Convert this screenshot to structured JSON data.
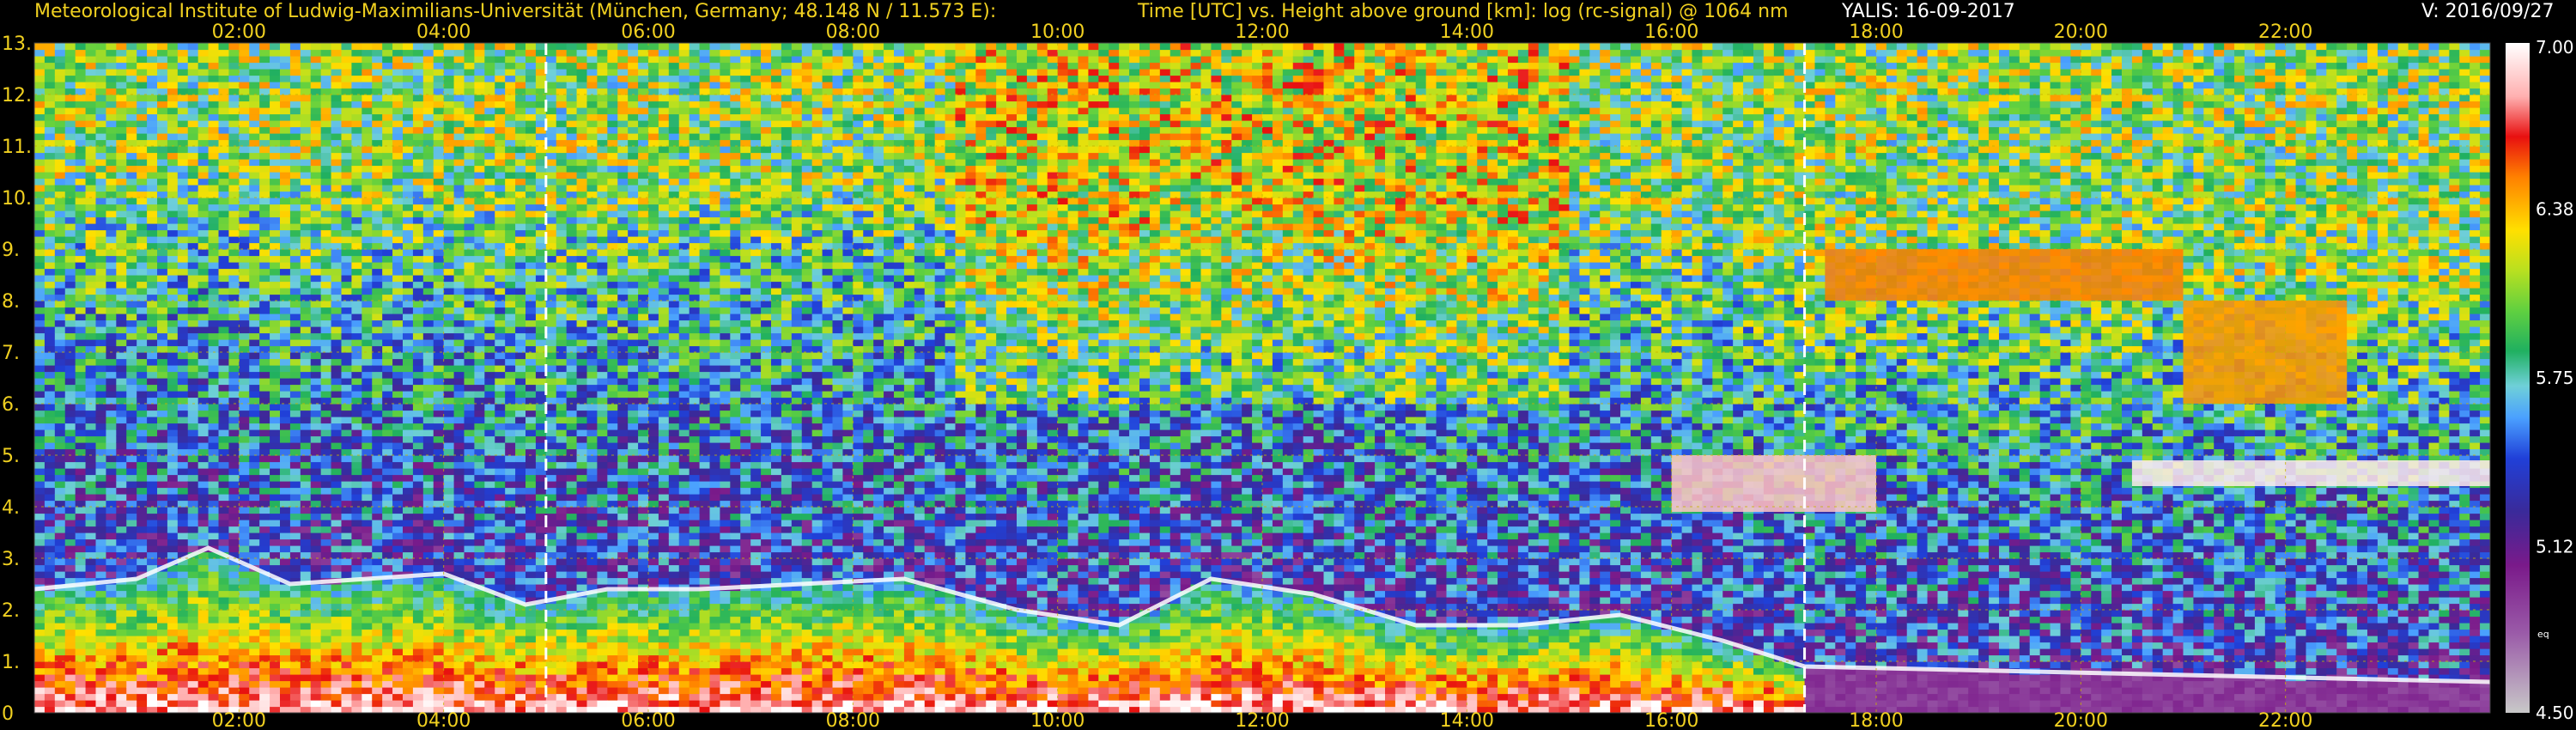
{
  "header": {
    "institute": "Meteorological Institute of Ludwig-Maximilians-Universität (München, Germany; 48.148 N / 11.573 E):",
    "description": "Time [UTC] vs. Height above ground [km]: log (rc-signal) @ 1064 nm",
    "instrument": "YALIS: 16-09-2017",
    "version": "V: 2016/09/27"
  },
  "colors": {
    "header_text": "#f0d020",
    "tick_text": "#f0d020",
    "grid": "#c8b400",
    "background": "#000000",
    "marker_line": "#ffffff",
    "colorbar_text": "#ffffff"
  },
  "chart_data": {
    "type": "heatmap",
    "x_unit": "hours UTC",
    "y_unit": "km",
    "x_range": [
      0,
      24
    ],
    "y_range": [
      0,
      13
    ],
    "x_ticks": [
      2,
      4,
      6,
      8,
      10,
      12,
      14,
      16,
      18,
      20,
      22
    ],
    "x_tick_labels": [
      "02:00",
      "04:00",
      "06:00",
      "08:00",
      "10:00",
      "12:00",
      "14:00",
      "16:00",
      "18:00",
      "20:00",
      "22:00"
    ],
    "y_ticks": [
      0,
      1,
      2,
      3,
      4,
      5,
      6,
      7,
      8,
      9,
      10,
      11,
      12,
      13
    ],
    "y_tick_labels": [
      "0",
      "1.",
      "2.",
      "3.",
      "4.",
      "5.",
      "6.",
      "7.",
      "8.",
      "9.",
      "10.",
      "11.",
      "12.",
      "13."
    ],
    "grid": true,
    "dashed_markers_x": [
      5.0,
      17.3
    ],
    "colorbar": {
      "range": [
        4.5,
        7.0
      ],
      "tick_values": [
        4.5,
        5.12,
        5.75,
        6.38,
        7.0
      ],
      "tick_labels": [
        "4.50",
        "5.12",
        "5.75",
        "6.38",
        "7.00"
      ],
      "note": "eq",
      "stops": [
        {
          "value": 4.5,
          "color": "#c8c8c8"
        },
        {
          "value": 4.8,
          "color": "#9a5aa8"
        },
        {
          "value": 5.05,
          "color": "#7a1a8a"
        },
        {
          "value": 5.25,
          "color": "#3a2a9a"
        },
        {
          "value": 5.45,
          "color": "#2040d8"
        },
        {
          "value": 5.6,
          "color": "#4aa0ff"
        },
        {
          "value": 5.72,
          "color": "#6fd0d8"
        },
        {
          "value": 5.85,
          "color": "#20b060"
        },
        {
          "value": 6.0,
          "color": "#60d040"
        },
        {
          "value": 6.15,
          "color": "#b8e020"
        },
        {
          "value": 6.3,
          "color": "#ffe000"
        },
        {
          "value": 6.5,
          "color": "#ff8000"
        },
        {
          "value": 6.65,
          "color": "#e81010"
        },
        {
          "value": 6.8,
          "color": "#ffb0b0"
        },
        {
          "value": 7.0,
          "color": "#ffffff"
        }
      ]
    },
    "features": {
      "boundary_layer_top": [
        {
          "t": 0.0,
          "h": 2.4
        },
        {
          "t": 1.0,
          "h": 2.6
        },
        {
          "t": 1.7,
          "h": 3.2
        },
        {
          "t": 2.5,
          "h": 2.5
        },
        {
          "t": 4.0,
          "h": 2.7
        },
        {
          "t": 4.8,
          "h": 2.1
        },
        {
          "t": 5.6,
          "h": 2.4
        },
        {
          "t": 6.5,
          "h": 2.4
        },
        {
          "t": 7.5,
          "h": 2.5
        },
        {
          "t": 8.5,
          "h": 2.6
        },
        {
          "t": 9.6,
          "h": 2.0
        },
        {
          "t": 10.6,
          "h": 1.7
        },
        {
          "t": 11.5,
          "h": 2.6
        },
        {
          "t": 12.5,
          "h": 2.3
        },
        {
          "t": 13.5,
          "h": 1.7
        },
        {
          "t": 14.5,
          "h": 1.7
        },
        {
          "t": 15.5,
          "h": 1.9
        },
        {
          "t": 16.5,
          "h": 1.4
        },
        {
          "t": 17.3,
          "h": 0.9
        },
        {
          "t": 24.0,
          "h": 0.6
        }
      ],
      "high_cloud_patches": [
        {
          "t_start": 16.0,
          "t_end": 18.0,
          "h_low": 3.9,
          "h_high": 5.0,
          "value": 6.85
        },
        {
          "t_start": 17.5,
          "t_end": 21.0,
          "h_low": 8.0,
          "h_high": 9.0,
          "value": 6.5
        },
        {
          "t_start": 21.0,
          "t_end": 22.6,
          "h_low": 6.0,
          "h_high": 8.0,
          "value": 6.45
        },
        {
          "t_start": 20.5,
          "t_end": 24.0,
          "h_low": 4.4,
          "h_high": 4.9,
          "value": 6.95
        }
      ]
    }
  }
}
